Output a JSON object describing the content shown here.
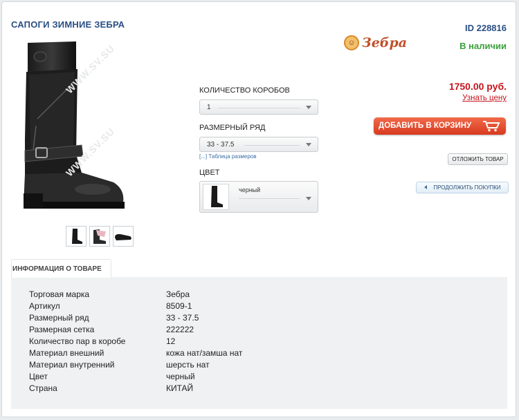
{
  "product": {
    "title": "САПОГИ ЗИМНИЕ ЗЕБРА",
    "id": "ID 228816",
    "stock": "В наличии",
    "brand_logo_text": "Зебра",
    "watermark": "WWW.SV.SU"
  },
  "options": {
    "boxes_label": "КОЛИЧЕСТВО КОРОБОВ",
    "boxes_value": "1",
    "size_label": "РАЗМЕРНЫЙ РЯД",
    "size_value": "33 - 37.5",
    "size_table_link": "[...] Таблица размеров",
    "color_label": "ЦВЕТ",
    "color_value": "черный"
  },
  "purchase": {
    "price": "1750.00 руб.",
    "ask_price": "Узнать цену",
    "add_to_cart": "ДОБАВИТЬ В КОРЗИНУ",
    "defer": "ОТЛОЖИТЬ ТОВАР",
    "continue": "ПРОДОЛЖИТЬ ПОКУПКИ"
  },
  "info": {
    "tab": "ИНФОРМАЦИЯ О ТОВАРЕ",
    "rows": [
      {
        "key": "Торговая марка",
        "value": "Зебра"
      },
      {
        "key": "Артикул",
        "value": "8509-1"
      },
      {
        "key": "Размерный ряд",
        "value": "33 - 37.5"
      },
      {
        "key": "Размерная сетка",
        "value": "222222"
      },
      {
        "key": "Количество пар в коробе",
        "value": "12"
      },
      {
        "key": "Материал внешний",
        "value": "кожа нат/замша нат"
      },
      {
        "key": "Материал внутренний",
        "value": "шерсть нат"
      },
      {
        "key": "Цвет",
        "value": "черный"
      },
      {
        "key": "Страна",
        "value": "КИТАЙ"
      }
    ]
  },
  "colors": {
    "title": "#2a4f84",
    "stock": "#3aa03a",
    "price": "#c4141c",
    "cart_button": "#e04a2c"
  }
}
